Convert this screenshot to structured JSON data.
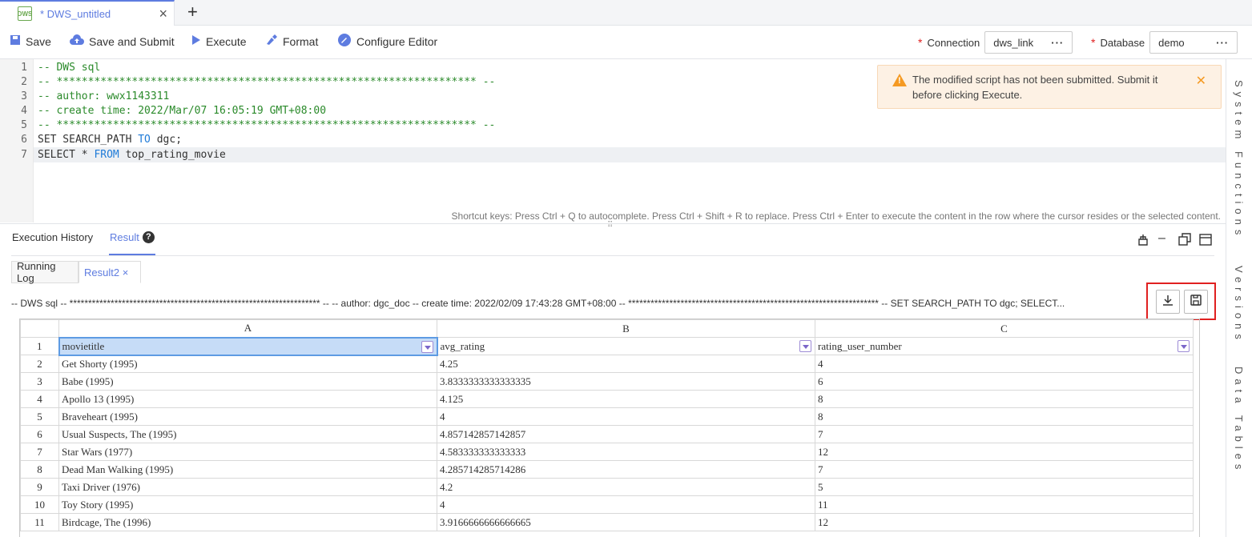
{
  "tab": {
    "icon": "DWS",
    "title": "* DWS_untitled",
    "close": "×",
    "add": "+"
  },
  "toolbar": {
    "save": "Save",
    "save_submit": "Save and Submit",
    "execute": "Execute",
    "format": "Format",
    "configure": "Configure Editor",
    "connection_label": "Connection",
    "connection_value": "dws_link",
    "database_label": "Database",
    "database_value": "demo",
    "required_mark": "*",
    "more": "···"
  },
  "editor": {
    "lines": [
      "-- DWS sql",
      "-- ******************************************************************* --",
      "-- author: wwx1143311",
      "-- create time: 2022/Mar/07 16:05:19 GMT+08:00",
      "-- ******************************************************************* --",
      "SET SEARCH_PATH TO dgc;",
      "SELECT * FROM top_rating_movie"
    ],
    "line_numbers": [
      "1",
      "2",
      "3",
      "4",
      "5",
      "6",
      "7"
    ],
    "shortcut_hint": "Shortcut keys: Press Ctrl + Q to autocomplete. Press Ctrl + Shift + R to replace. Press Ctrl + Enter to execute the content in the row where the cursor resides or the selected content."
  },
  "alert": {
    "message": "The modified script has not been submitted. Submit it before clicking Execute."
  },
  "side_panel": {
    "items": [
      "System Functions",
      "Versions",
      "Data Tables"
    ]
  },
  "results": {
    "tabs": [
      "Execution History",
      "Result"
    ],
    "active_tab": "Result",
    "subtabs": [
      "Running Log",
      "Result2 ×"
    ],
    "sql_preview": "-- DWS sql -- ******************************************************************* -- -- author: dgc_doc -- create time: 2022/02/09 17:43:28 GMT+08:00 -- ******************************************************************* -- SET SEARCH_PATH TO dgc; SELECT...",
    "watermark": "dgc_doc"
  },
  "sheet": {
    "col_letters": [
      "A",
      "B",
      "C"
    ],
    "headers": [
      "movietitle",
      "avg_rating",
      "rating_user_number"
    ],
    "rows": [
      [
        "Get Shorty (1995)",
        "4.25",
        "4"
      ],
      [
        "Babe (1995)",
        "3.8333333333333335",
        "6"
      ],
      [
        "Apollo 13 (1995)",
        "4.125",
        "8"
      ],
      [
        "Braveheart (1995)",
        "4",
        "8"
      ],
      [
        "Usual Suspects, The (1995)",
        "4.857142857142857",
        "7"
      ],
      [
        "Star Wars (1977)",
        "4.583333333333333",
        "12"
      ],
      [
        "Dead Man Walking (1995)",
        "4.285714285714286",
        "7"
      ],
      [
        "Taxi Driver (1976)",
        "4.2",
        "5"
      ],
      [
        "Toy Story (1995)",
        "4",
        "11"
      ],
      [
        "Birdcage, The (1996)",
        "3.9166666666666665",
        "12"
      ]
    ],
    "row_numbers": [
      "1",
      "2",
      "3",
      "4",
      "5",
      "6",
      "7",
      "8",
      "9",
      "10",
      "11"
    ]
  }
}
